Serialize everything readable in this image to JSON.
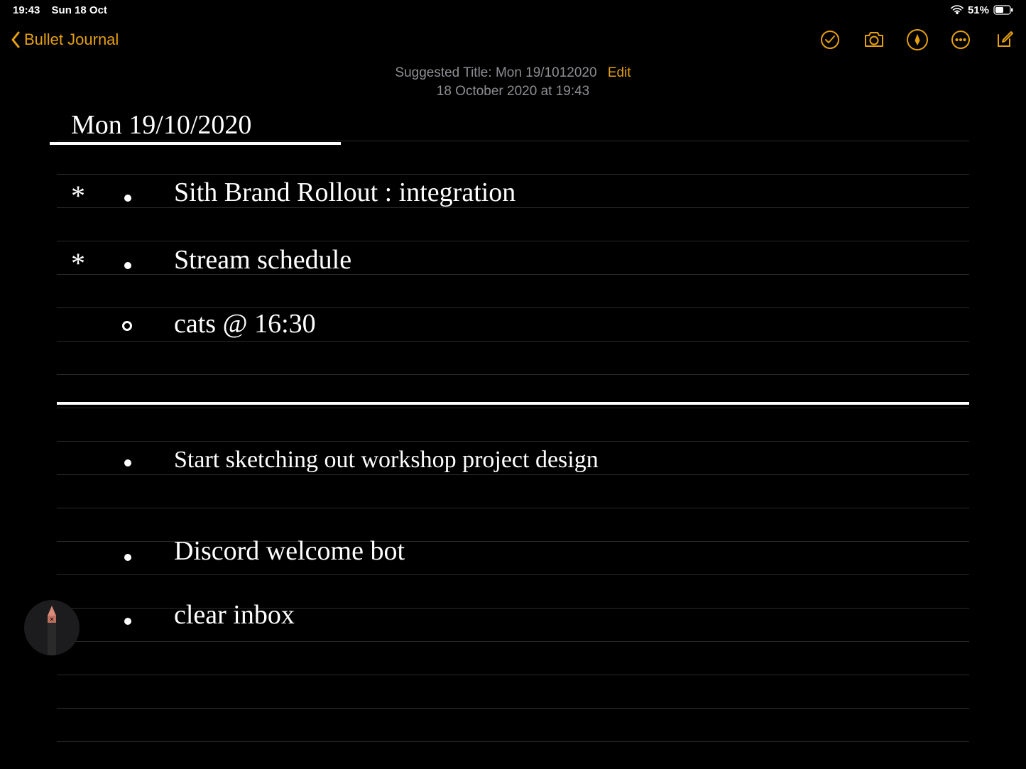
{
  "status": {
    "time": "19:43",
    "date": "Sun 18 Oct",
    "battery_pct": "51%"
  },
  "nav": {
    "back_label": "Bullet Journal"
  },
  "header": {
    "suggested_prefix": "Suggested Title:",
    "suggested_title": "Mon 19/1012020",
    "edit_label": "Edit",
    "timestamp": "18 October 2020 at 19:43"
  },
  "note": {
    "title": "Mon  19/10/2020",
    "items": [
      {
        "star": true,
        "bullet": "dot",
        "text": "Sith Brand Rollout : integration"
      },
      {
        "star": true,
        "bullet": "dot",
        "text": "Stream schedule"
      },
      {
        "star": false,
        "bullet": "ring",
        "text": "cats @ 16:30"
      }
    ],
    "below": [
      {
        "bullet": "dot",
        "text": "Start sketching out workshop project design"
      },
      {
        "bullet": "dot",
        "text": "Discord welcome bot"
      },
      {
        "bullet": "dot",
        "text": "clear inbox"
      }
    ]
  },
  "colors": {
    "accent": "#e5a011"
  }
}
